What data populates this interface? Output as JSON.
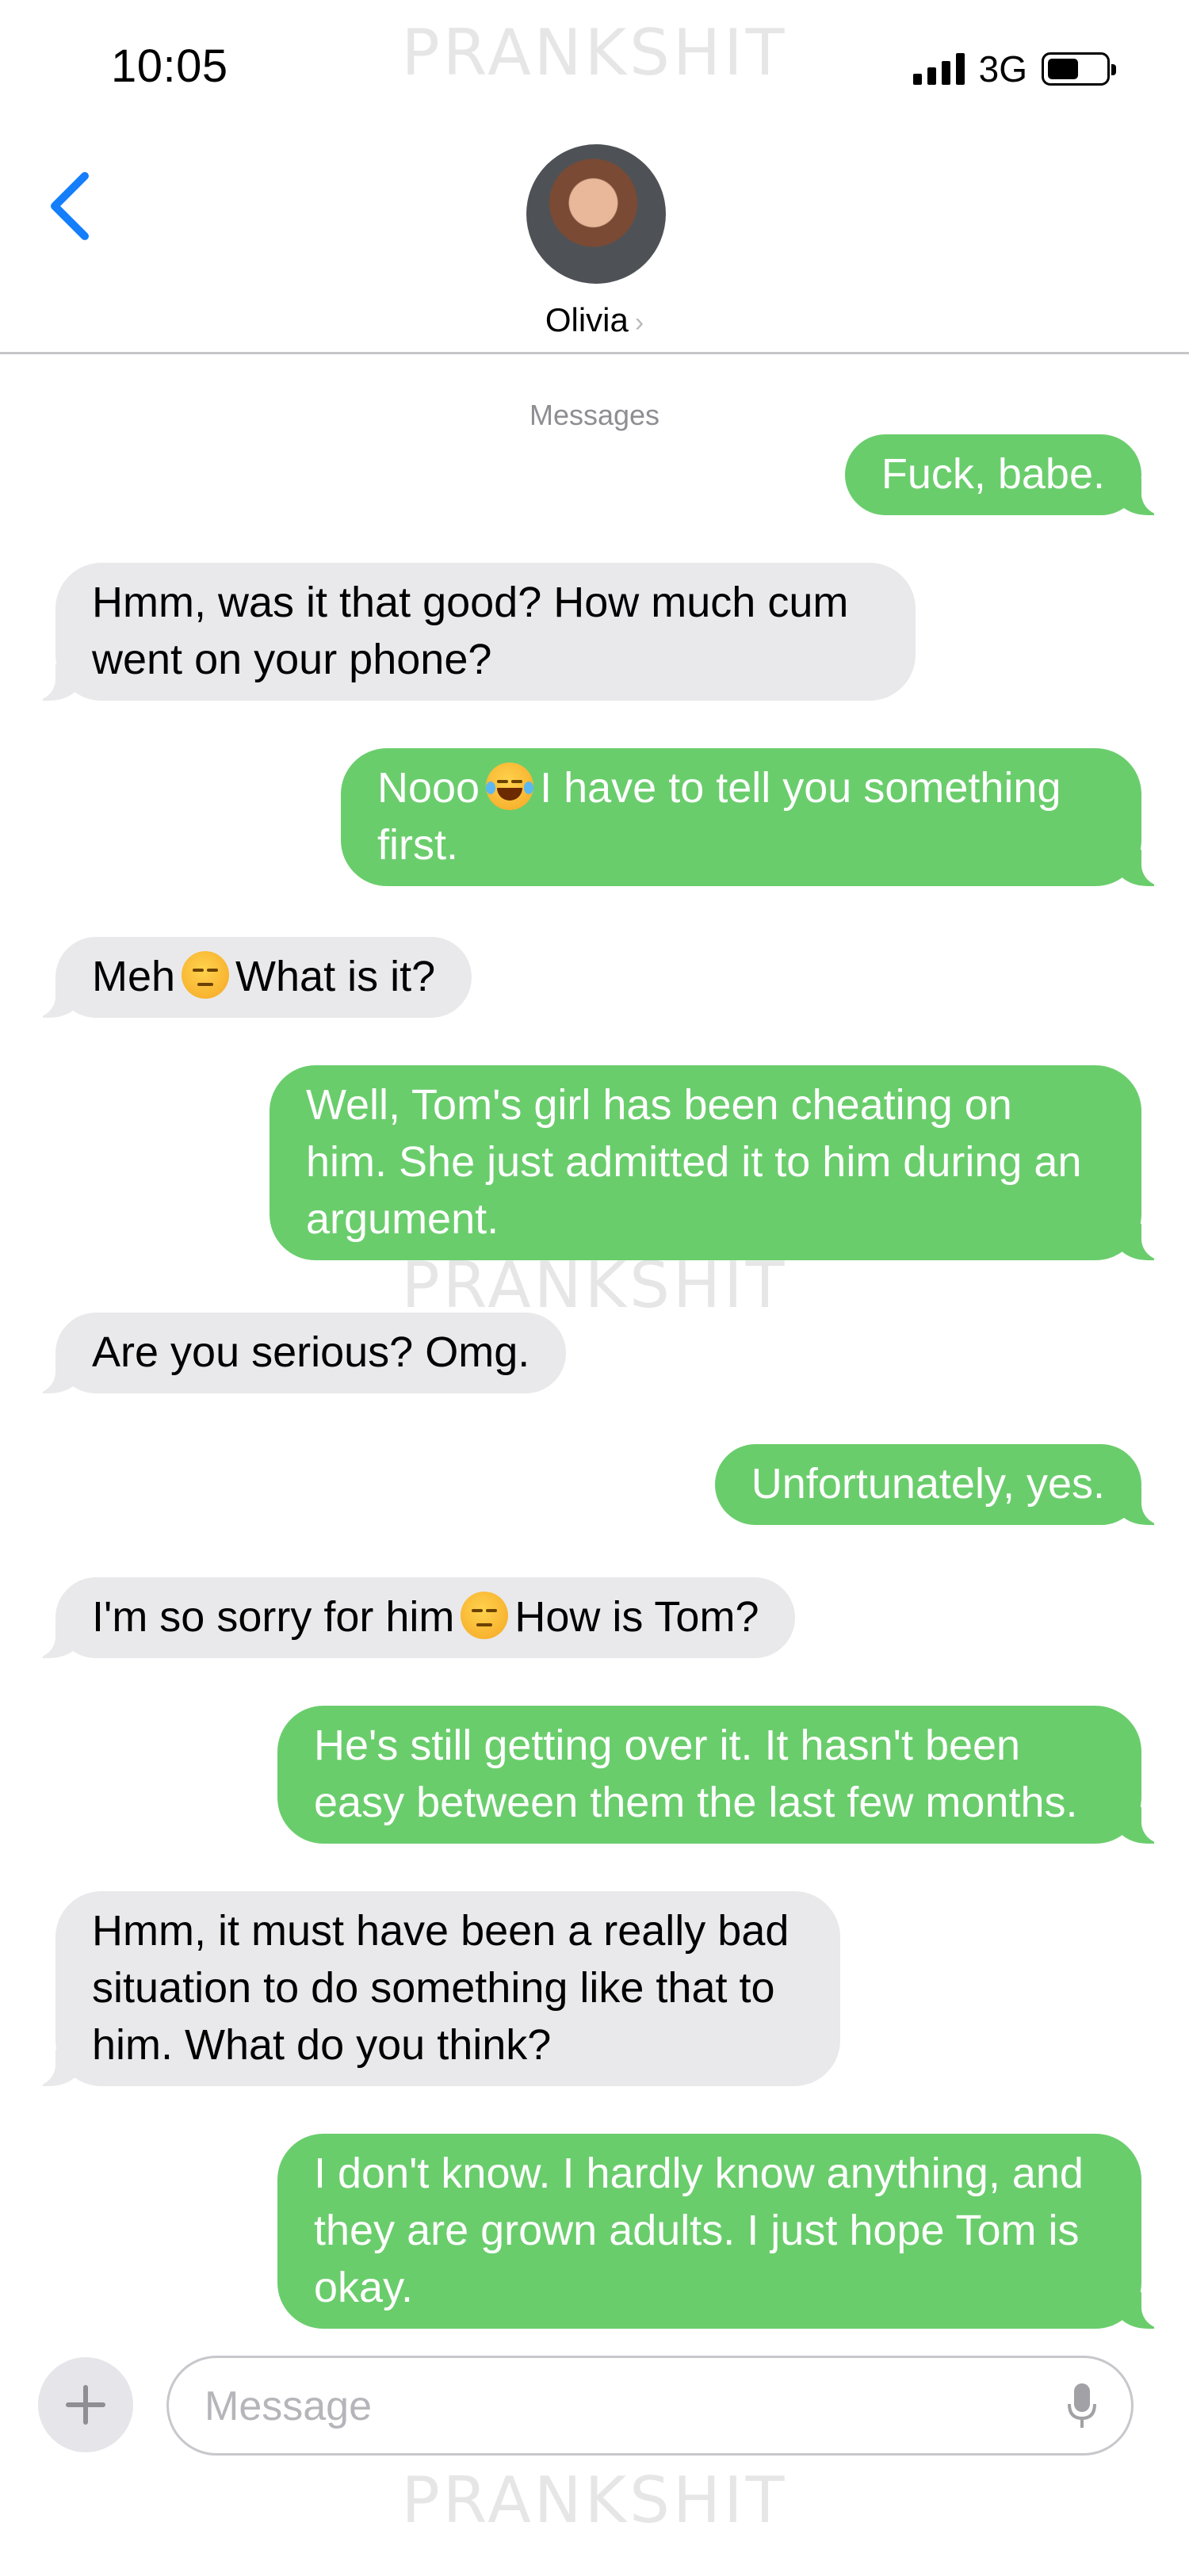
{
  "status_bar": {
    "time": "10:05",
    "network": "3G",
    "signal_bars": 4,
    "battery_level": 0.55
  },
  "watermark": "PRANKSHIT",
  "header": {
    "contact_name": "Olivia",
    "chevron": "›"
  },
  "service_label": "Messages",
  "messages": [
    {
      "dir": "out",
      "text": "Fuck, babe."
    },
    {
      "dir": "in",
      "text": "Hmm, was it that good? How much cum\nwent on your phone?"
    },
    {
      "dir": "out",
      "parts": [
        "Nooo",
        "I have to tell you something\nfirst."
      ],
      "emoji": "face-with-tears-of-joy-icon"
    },
    {
      "dir": "in",
      "parts": [
        "Meh",
        "What is it?"
      ],
      "emoji": "pensive-face-icon"
    },
    {
      "dir": "out",
      "text": "Well, Tom's girl has been cheating on\nhim. She just admitted it to him during an\nargument."
    },
    {
      "dir": "in",
      "text": "Are you serious? Omg."
    },
    {
      "dir": "out",
      "text": "Unfortunately, yes."
    },
    {
      "dir": "in",
      "parts": [
        "I'm so sorry for him",
        "How is Tom?"
      ],
      "emoji": "pensive-face-icon"
    },
    {
      "dir": "out",
      "text": "He's still getting over it. It hasn't been\neasy between them the last few months."
    },
    {
      "dir": "in",
      "text": "Hmm, it must have been a really bad\nsituation to do something like that to\nhim. What do you think?"
    },
    {
      "dir": "out",
      "text": "I don't know. I hardly know anything, and\nthey are grown adults. I just hope Tom is\nokay."
    }
  ],
  "composer": {
    "placeholder": "Message"
  },
  "colors": {
    "outgoing_bubble": "#6acd6c",
    "incoming_bubble": "#e9e9eb",
    "accent": "#147efb"
  }
}
